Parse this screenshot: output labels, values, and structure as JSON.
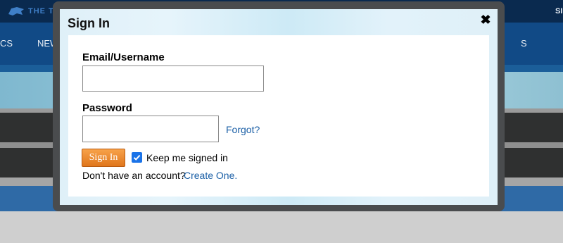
{
  "background": {
    "logo_text": "THE TR",
    "top_right_text": "SI",
    "nav_items": [
      "CS",
      "NEW",
      "S"
    ]
  },
  "modal": {
    "title": "Sign In",
    "close_symbol": "✖",
    "email_label": "Email/Username",
    "email_value": "",
    "password_label": "Password",
    "password_value": "",
    "forgot_link": "Forgot?",
    "signin_button": "Sign In",
    "keep_signed_in": {
      "label": "Keep me signed in",
      "checked": true
    },
    "no_account_text": "Don't have an account?",
    "create_link": "Create One."
  },
  "colors": {
    "link": "#1a5fa6",
    "signin_button": "#e0761c",
    "checkbox": "#1a73e8",
    "nav_bar": "#114a86",
    "top_bar": "#0a2a4f"
  }
}
